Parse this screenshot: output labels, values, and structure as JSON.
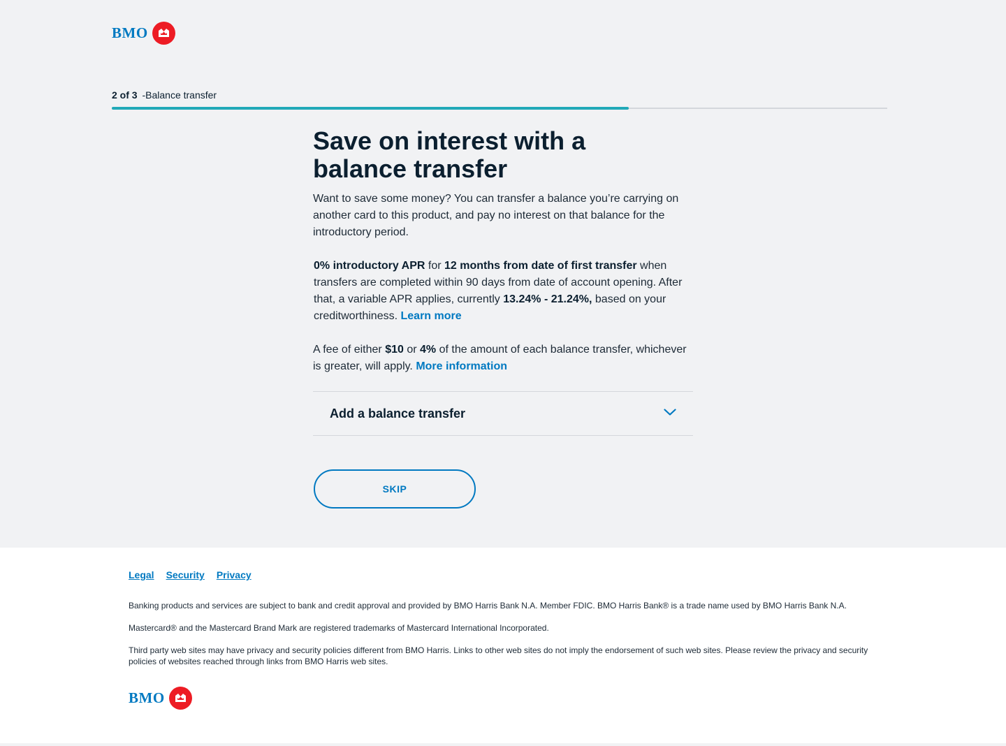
{
  "brand": {
    "name": "BMO",
    "logo_icon": "bmo-roundel-icon",
    "color": "#0079c1",
    "roundel_color": "#ed1c24"
  },
  "progress": {
    "step": "2 of 3",
    "separator": "-",
    "label": "Balance transfer",
    "fraction": 0.667,
    "color": "#21a9b8"
  },
  "main": {
    "title": "Save on interest with a balance transfer",
    "intro": "Want to save some money? You can transfer a balance you’re carrying on another card to this product, and pay no interest on that balance for the introductory period.",
    "apr": {
      "bold1": "0% introductory APR",
      "text1": " for ",
      "bold2": "12 months from date of first transfer",
      "text2": " when transfers are completed within 90 days from date of account opening. After that, a variable APR applies, currently ",
      "bold3": "13.24% - 21.24%,",
      "text3": " based on your creditworthiness. ",
      "link": "Learn more"
    },
    "fee": {
      "text1": "A fee of either ",
      "bold1": "$10",
      "text2": " or ",
      "bold2": "4%",
      "text3": " of the amount of each balance transfer, whichever is greater, will apply. ",
      "link": "More information"
    },
    "accordion": {
      "title": "Add a balance transfer",
      "icon": "chevron-down-icon"
    },
    "skip_label": "SKIP"
  },
  "footer": {
    "links": [
      "Legal",
      "Security",
      "Privacy"
    ],
    "legal": [
      "Banking products and services are subject to bank and credit approval and provided by BMO Harris Bank N.A. Member FDIC. BMO Harris Bank® is a trade name used by BMO Harris Bank N.A.",
      "Mastercard® and the Mastercard Brand Mark are registered trademarks of Mastercard International Incorporated.",
      "Third party web sites may have privacy and security policies different from BMO Harris. Links to other web sites do not imply the endorsement of such web sites. Please review the privacy and security policies of websites reached through links from BMO Harris web sites."
    ]
  }
}
